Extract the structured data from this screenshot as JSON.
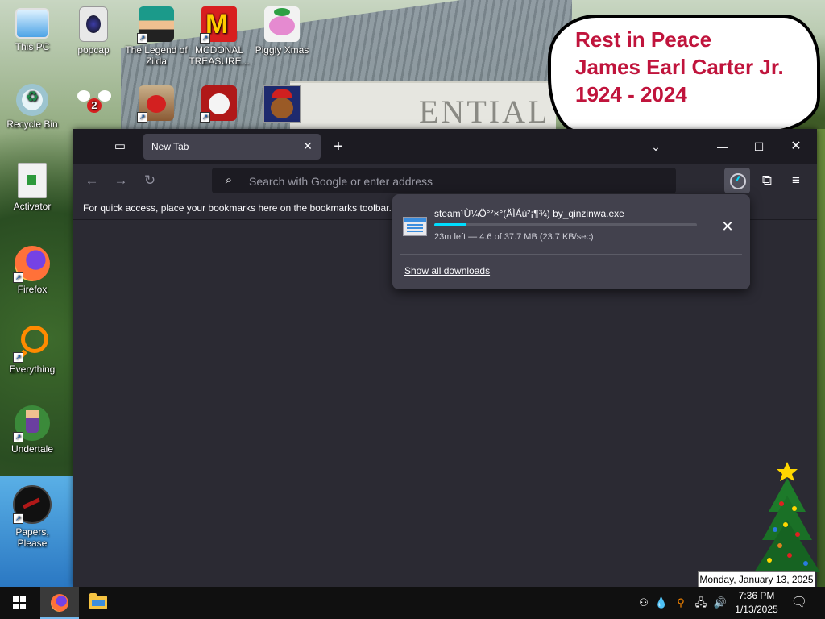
{
  "desktop": {
    "bubble": {
      "line1": "Rest in Peace",
      "line2": "James Earl Carter Jr.",
      "line3": "1924 - 2024"
    },
    "wallpaper_text": "ENTIAL",
    "icons": {
      "this_pc": "This PC",
      "popcap": "popcap",
      "legend_zilda": "The Legend of Zilda",
      "mcdonal": "MCDONAL TREASURE...",
      "piggly": "Piggly Xmas",
      "recycle_bin": "Recycle Bin",
      "activator": "Activator",
      "firefox": "Firefox",
      "everything": "Everything",
      "undertale": "Undertale",
      "papers_please": "Papers, Please"
    }
  },
  "browser": {
    "tab": {
      "title": "New Tab",
      "close_icon": "close-icon"
    },
    "urlbar": {
      "placeholder": "Search with Google or enter address"
    },
    "bookmarks_toolbar_text": "For quick access, place your bookmarks here on the bookmarks toolbar.",
    "download": {
      "filename": "steam¹Ù¼Ö°²×°(ÄÌÁú²¡¶¾) by_qinzinwa.exe",
      "status": "23m left — 4.6 of 37.7 MB (23.7 KB/sec)",
      "progress_fraction": 0.122,
      "show_all": "Show all downloads"
    }
  },
  "tooltip": {
    "date": "Monday, January 13, 2025"
  },
  "taskbar": {
    "clock_time": "7:36 PM",
    "clock_date": "1/13/2025"
  },
  "colors": {
    "accent": "#00ddff",
    "bubble_text": "#c0143c",
    "browser_bg": "#2b2a33",
    "tabstrip_bg": "#1c1b22"
  }
}
